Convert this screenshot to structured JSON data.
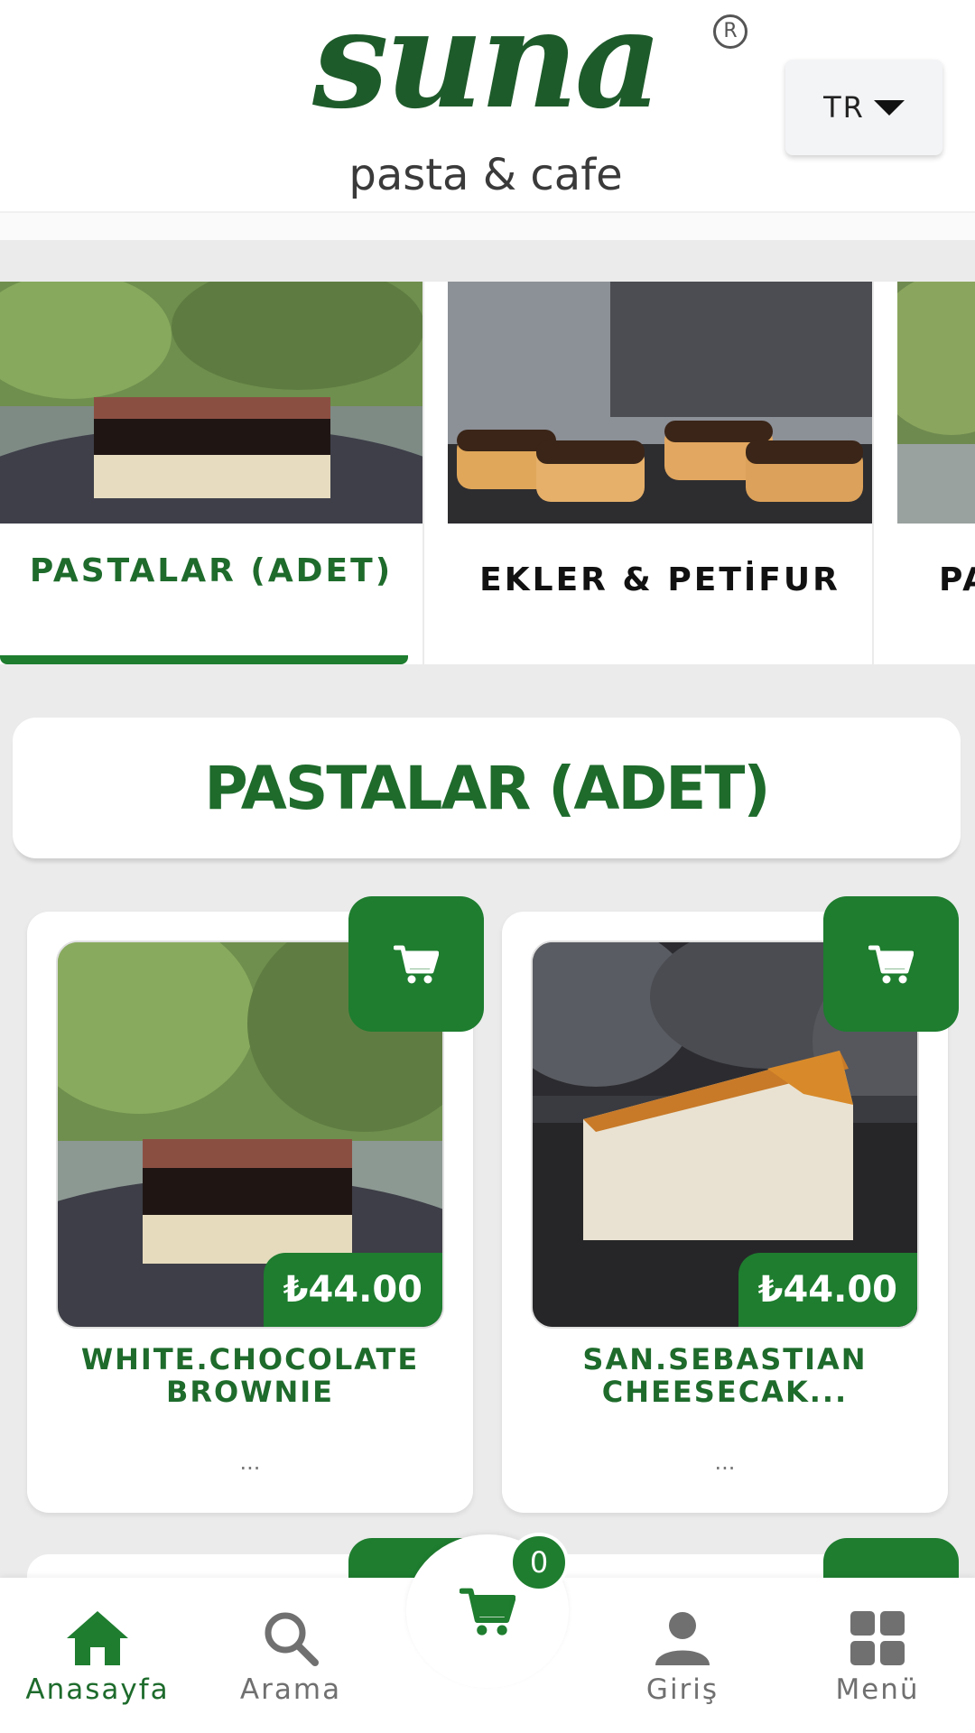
{
  "brand": {
    "logo_word": "suna",
    "logo_reg": "R",
    "logo_sub": "pasta & cafe",
    "color": "#1e7d2f"
  },
  "language": {
    "label": "TR",
    "icon": "caret-down-icon"
  },
  "categories": [
    {
      "label": "PASTALAR (ADET)",
      "active": true
    },
    {
      "label": "EKLER & PETİFUR",
      "active": false
    },
    {
      "label": "PA",
      "active": false
    }
  ],
  "section": {
    "title": "PASTALAR (ADET)"
  },
  "products": [
    {
      "name_line1": "WHITE.CHOCOLATE",
      "name_line2": "BROWNIE",
      "price": "₺44.00",
      "description": "...",
      "cart_icon": "cart-icon"
    },
    {
      "name_line1": "SAN.SEBASTIAN",
      "name_line2": "CHEESECAK...",
      "price": "₺44.00",
      "description": "...",
      "cart_icon": "cart-icon"
    }
  ],
  "bottom_nav": {
    "home": "Anasayfa",
    "search": "Arama",
    "cart_count": "0",
    "login": "Giriş",
    "menu": "Menü"
  }
}
